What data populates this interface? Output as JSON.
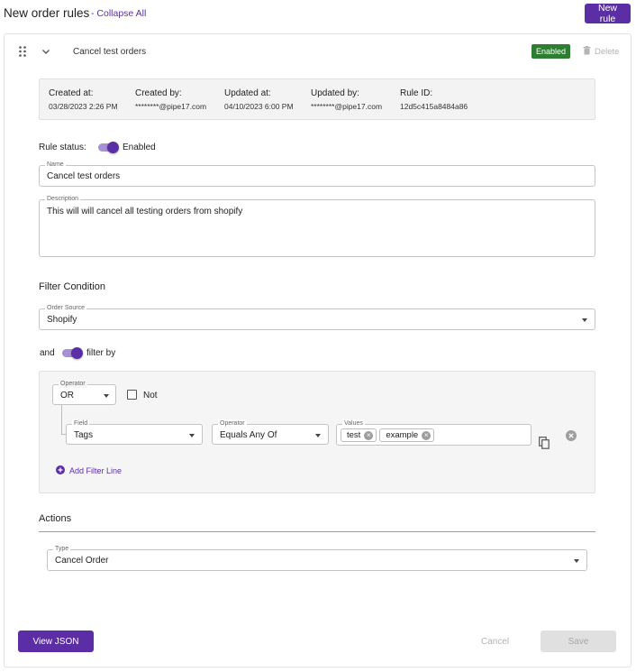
{
  "header": {
    "title": "New order rules",
    "collapse_all": "- Collapse All",
    "new_rule_button": "New rule"
  },
  "rule": {
    "name": "Cancel test orders",
    "status_badge": "Enabled",
    "delete_label": "Delete",
    "meta": [
      {
        "label": "Created at:",
        "value": "03/28/2023 2:26 PM"
      },
      {
        "label": "Created by:",
        "value": "********@pipe17.com"
      },
      {
        "label": "Updated at:",
        "value": "04/10/2023 6:00 PM"
      },
      {
        "label": "Updated by:",
        "value": "********@pipe17.com"
      },
      {
        "label": "Rule ID:",
        "value": "12d5c415a8484a86"
      }
    ],
    "rule_status_label": "Rule status:",
    "rule_status_value": "Enabled",
    "rule_status_on": true,
    "name_field": {
      "label": "Name",
      "value": "Cancel test orders"
    },
    "description_field": {
      "label": "Description",
      "value": "This will will cancel all testing orders from shopify"
    }
  },
  "filter": {
    "section_title": "Filter Condition",
    "order_source": {
      "label": "Order Source",
      "value": "Shopify"
    },
    "and_label": "and",
    "filter_by_label": "filter by",
    "filter_by_on": true,
    "group_operator": {
      "label": "Operator",
      "value": "OR"
    },
    "not_label": "Not",
    "not_checked": false,
    "line": {
      "field": {
        "label": "Field",
        "value": "Tags"
      },
      "operator": {
        "label": "Operator",
        "value": "Equals Any Of"
      },
      "values_label": "Values",
      "values": [
        "test",
        "example"
      ]
    },
    "add_filter_line": "Add Filter Line"
  },
  "actions": {
    "section_title": "Actions",
    "type": {
      "label": "Type",
      "value": "Cancel Order"
    }
  },
  "footer": {
    "view_json": "View JSON",
    "cancel": "Cancel",
    "save": "Save"
  },
  "colors": {
    "accent": "#5b2ea6",
    "enabled_green": "#2e7d32"
  },
  "icons": [
    "drag-handle-icon",
    "chevron-down-icon",
    "trash-icon",
    "copy-icon",
    "remove-circle-icon",
    "add-circle-icon"
  ]
}
